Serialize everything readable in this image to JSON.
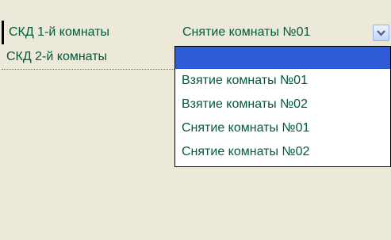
{
  "rows": [
    {
      "label": "СКД 1-й комнаты"
    },
    {
      "label": "СКД 2-й комнаты"
    }
  ],
  "combo": {
    "value": "Снятие комнаты №01",
    "options": [
      "",
      "Взятие комнаты №01",
      "Взятие комнаты №02",
      "Снятие комнаты №01",
      "Снятие комнаты №02"
    ],
    "highlighted_index": 0
  },
  "icons": {
    "dropdown_button": "chevron-down-icon"
  },
  "colors": {
    "text": "#005a3c",
    "highlight": "#2e5bd6",
    "background": "#ece9d8"
  }
}
